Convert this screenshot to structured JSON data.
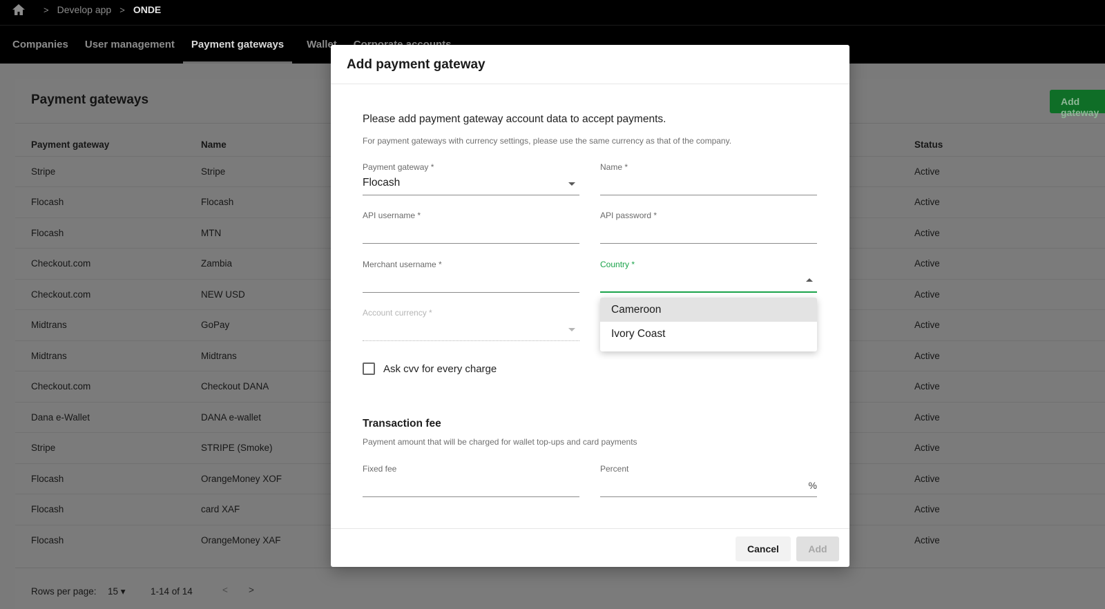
{
  "breadcrumb": {
    "items": [
      "Develop app",
      "ONDE"
    ]
  },
  "tabs": [
    "Companies",
    "User management",
    "Payment gateways",
    "Wallet",
    "Corporate accounts"
  ],
  "active_tab": "Payment gateways",
  "card": {
    "title": "Payment gateways",
    "add_button": "Add gateway"
  },
  "table": {
    "columns": [
      "Payment gateway",
      "Name",
      "Status"
    ],
    "rows": [
      [
        "Stripe",
        "Stripe",
        "Active"
      ],
      [
        "Flocash",
        "Flocash",
        "Active"
      ],
      [
        "Flocash",
        "MTN",
        "Active"
      ],
      [
        "Checkout.com",
        "Zambia",
        "Active"
      ],
      [
        "Checkout.com",
        "NEW USD",
        "Active"
      ],
      [
        "Midtrans",
        "GoPay",
        "Active"
      ],
      [
        "Midtrans",
        "Midtrans",
        "Active"
      ],
      [
        "Checkout.com",
        "Checkout DANA",
        "Active"
      ],
      [
        "Dana e-Wallet",
        "DANA e-wallet",
        "Active"
      ],
      [
        "Stripe",
        "STRIPE (Smoke)",
        "Active"
      ],
      [
        "Flocash",
        "OrangeMoney XOF",
        "Active"
      ],
      [
        "Flocash",
        "card XAF",
        "Active"
      ],
      [
        "Flocash",
        "OrangeMoney XAF",
        "Active"
      ]
    ]
  },
  "pagination": {
    "rows_per_page_label": "Rows per page:",
    "rows_per_page": "15",
    "range": "1-14 of 14"
  },
  "dialog": {
    "title": "Add payment gateway",
    "intro": "Please add payment gateway account data to accept payments.",
    "note": "For payment gateways with currency settings, please use the same currency as that of the company.",
    "fields": {
      "payment_gateway": {
        "label": "Payment gateway *",
        "value": "Flocash"
      },
      "name": {
        "label": "Name *",
        "value": ""
      },
      "api_username": {
        "label": "API username *",
        "value": ""
      },
      "api_password": {
        "label": "API password *",
        "value": ""
      },
      "merchant_username": {
        "label": "Merchant username *",
        "value": ""
      },
      "country": {
        "label": "Country *",
        "value": ""
      },
      "account_currency": {
        "label": "Account currency *",
        "value": ""
      },
      "fixed_fee": {
        "label": "Fixed fee",
        "value": ""
      },
      "percent": {
        "label": "Percent",
        "value": "",
        "suffix": "%"
      }
    },
    "checkbox": {
      "label": "Ask cvv for every charge",
      "checked": false
    },
    "fee_section": {
      "title": "Transaction fee",
      "subtitle": "Payment amount that will be charged for wallet top-ups and card payments"
    },
    "buttons": {
      "cancel": "Cancel",
      "add": "Add"
    }
  },
  "country_dropdown": {
    "options": [
      "Cameroon",
      "Ivory Coast"
    ],
    "highlighted": "Cameroon"
  },
  "colors": {
    "accent_green": "#1aa34a",
    "add_gateway_button": "#0f6e27"
  }
}
